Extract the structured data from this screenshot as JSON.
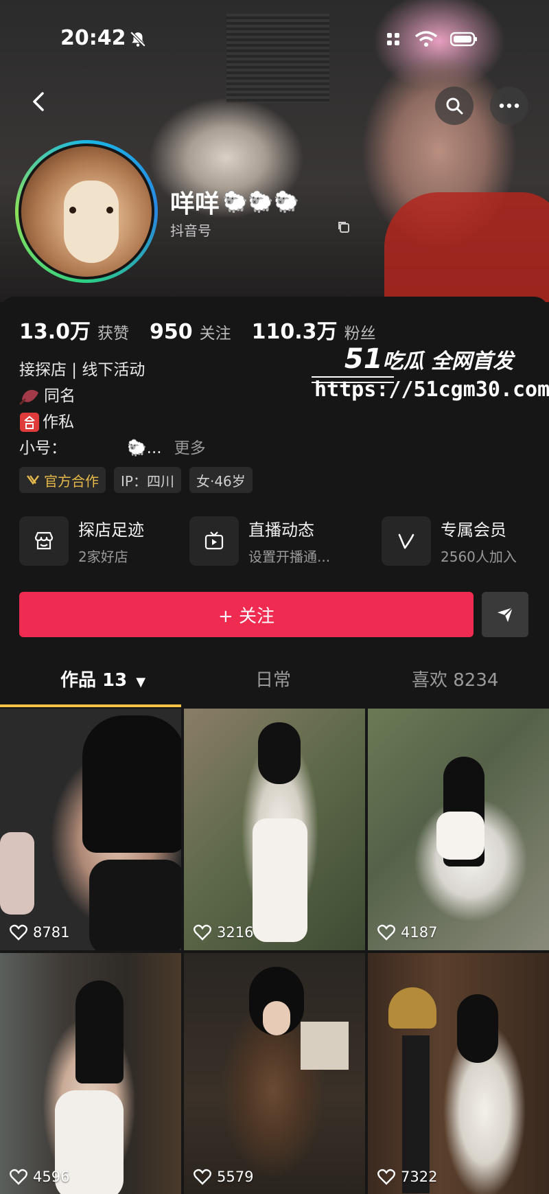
{
  "status_bar": {
    "time": "20:42"
  },
  "profile": {
    "nickname": "咩咩",
    "nickname_emoji": "🐑🐑🐑",
    "douyin_id_label": "抖音号"
  },
  "stats": [
    {
      "value": "13.0万",
      "label": "获赞"
    },
    {
      "value": "950",
      "label": "关注"
    },
    {
      "value": "110.3万",
      "label": "粉丝"
    }
  ],
  "bio": {
    "line1": "接探店 | 线下活动",
    "line2": "同名",
    "line3": "作私",
    "line4_prefix": "小号：",
    "line4_tail": "🐑...",
    "more": "更多"
  },
  "watermark": {
    "brand_num": "51",
    "brand_text": "吃瓜 全网首发",
    "url": "https://51cgm30.com"
  },
  "tags": [
    {
      "label": "官方合作"
    },
    {
      "label": "IP：四川"
    },
    {
      "label": "女·46岁"
    }
  ],
  "services": [
    {
      "title": "探店足迹",
      "subtitle": "2家好店"
    },
    {
      "title": "直播动态",
      "subtitle": "设置开播通..."
    },
    {
      "title": "专属会员",
      "subtitle": "2560人加入"
    }
  ],
  "actions": {
    "follow": "+ 关注"
  },
  "tabs": [
    {
      "label": "作品 13"
    },
    {
      "label": "日常"
    },
    {
      "label": "喜欢 8234"
    }
  ],
  "videos": [
    {
      "likes": "8781"
    },
    {
      "likes": "3216"
    },
    {
      "likes": "4187"
    },
    {
      "likes": "4596"
    },
    {
      "likes": "5579"
    },
    {
      "likes": "7322"
    }
  ],
  "colors": {
    "accent": "#f02b51",
    "tab_indicator": "#f6c343",
    "background": "#161616"
  }
}
